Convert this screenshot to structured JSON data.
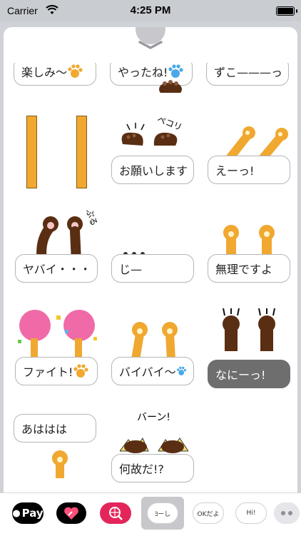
{
  "status_bar": {
    "carrier": "Carrier",
    "time": "4:25 PM"
  },
  "stickers": [
    {
      "label": "楽しみ～"
    },
    {
      "label": "やったね!"
    },
    {
      "label": "ずこ———っ"
    },
    {
      "label": ""
    },
    {
      "label": "お願いします",
      "sfx": "ペコリ"
    },
    {
      "label": "えーっ!"
    },
    {
      "label": "ヤバイ・・・",
      "sfx": "ぷる"
    },
    {
      "label": "じ—"
    },
    {
      "label": "無理ですよ"
    },
    {
      "label": "ファイト!"
    },
    {
      "label": "バイバイ～"
    },
    {
      "label": "なにーっ!"
    },
    {
      "label": "あははは"
    },
    {
      "label": "何故だ!?",
      "sfx": "バーン!"
    }
  ],
  "dock": {
    "apple_pay_label": "Pay",
    "thumb1_label": "ﾖーし",
    "thumb2_label": "OKだよ",
    "thumb3_label": "Hi!"
  },
  "colors": {
    "paw_orange": "#f0a830",
    "paw_brown": "#5a2e12",
    "pad_orange": "#f0a830",
    "pad_blue": "#4aa8e8"
  }
}
